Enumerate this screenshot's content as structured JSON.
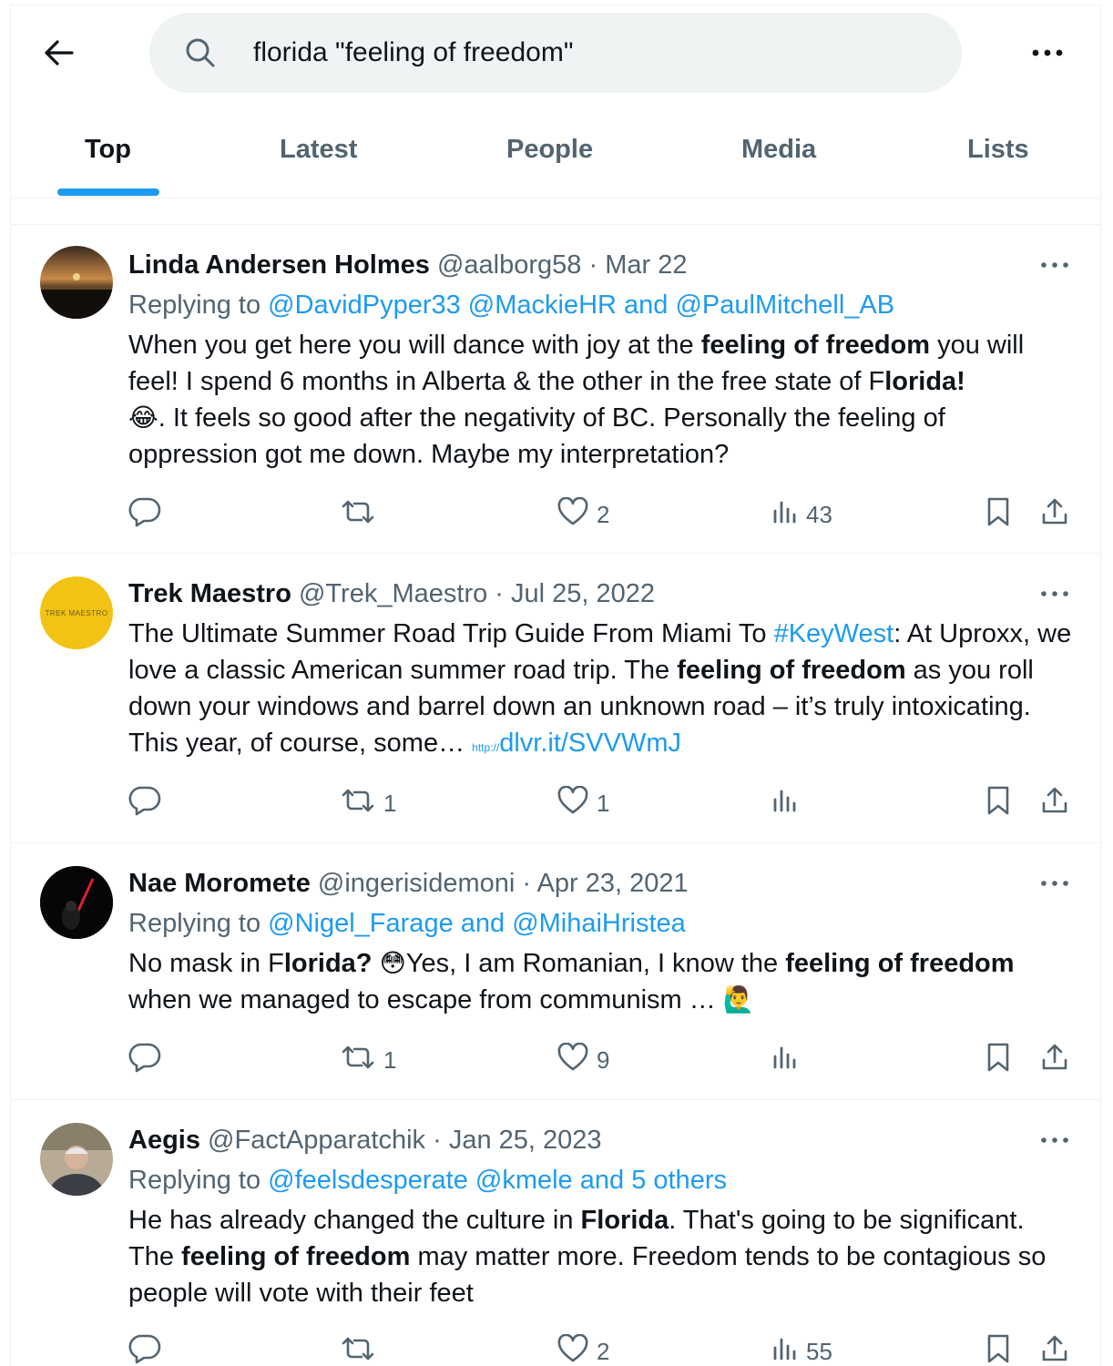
{
  "search": {
    "value": "florida \"feeling of freedom\""
  },
  "tabs": [
    {
      "label": "Top"
    },
    {
      "label": "Latest"
    },
    {
      "label": "People"
    },
    {
      "label": "Media"
    },
    {
      "label": "Lists"
    }
  ],
  "tweets": [
    {
      "name": "Linda Andersen Holmes",
      "handle": "@aalborg58",
      "date": "Mar 22",
      "replying_prefix": "Replying to",
      "replying_links": "@DavidPyper33 @MackieHR and @PaulMitchell_AB",
      "text": {
        "p1": "When you get here you will dance with joy at the ",
        "b1": "feeling of freedom",
        "p2": " you will feel! I spend 6 months in Alberta & the other in the free state of F",
        "b2": "lorida!",
        "emoji": "😂",
        "p3": ". It feels so good after the negativity of BC. Personally the feeling of oppression got me down. Maybe my interpretation?"
      },
      "counts": {
        "reply": "",
        "retweet": "",
        "like": "2",
        "views": "43"
      }
    },
    {
      "name": "Trek Maestro",
      "handle": "@Trek_Maestro",
      "date": "Jul 25, 2022",
      "avatar_text": "TREK MAESTRO",
      "text": {
        "p1": "The Ultimate Summer Road Trip Guide From Miami To ",
        "hashtag": "#KeyWest",
        "p2": ": At Uproxx, we love a classic American summer road trip. The ",
        "b1": "feeling of freedom",
        "p3": " as you roll down your windows and barrel down an unknown road – it’s truly intoxicating. This year, of course, some… ",
        "link_prefix": "http://",
        "link": "dlvr.it/SVVWmJ"
      },
      "counts": {
        "reply": "",
        "retweet": "1",
        "like": "1",
        "views": ""
      }
    },
    {
      "name": "Nae Moromete",
      "handle": "@ingerisidemoni",
      "date": "Apr 23, 2021",
      "replying_prefix": "Replying to",
      "replying_links": "@Nigel_Farage and @MihaiHristea",
      "text": {
        "p1": "No mask in F",
        "b1": "lorida?",
        "emoji1": "😳",
        "p2": "Yes, I am Romanian, I know the ",
        "b2": "feeling of freedom",
        "p3": " when we managed to escape from communism … ",
        "emoji2": "🙋‍♂️"
      },
      "counts": {
        "reply": "",
        "retweet": "1",
        "like": "9",
        "views": ""
      }
    },
    {
      "name": "Aegis",
      "handle": "@FactApparatchik",
      "date": "Jan 25, 2023",
      "replying_prefix": "Replying to",
      "replying_links": "@feelsdesperate @kmele and 5 others",
      "text": {
        "p1": "He has already changed the culture in ",
        "b1": "Florida",
        "p2": ". That's going to be significant. The ",
        "b2": "feeling of freedom",
        "p3": " may matter more.  Freedom tends to be contagious so people will vote with their feet"
      },
      "counts": {
        "reply": "",
        "retweet": "",
        "like": "2",
        "views": "55"
      }
    }
  ],
  "colors": {
    "accent": "#1d9bf0",
    "muted": "#536471",
    "text": "#0f1419"
  }
}
